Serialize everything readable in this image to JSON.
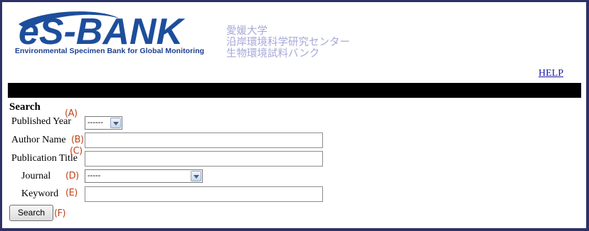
{
  "header": {
    "logo_text": "eS-BANK",
    "tagline": "Environmental Specimen Bank for Global Monitoring",
    "jp_lines": [
      "愛媛大学",
      "沿岸環境科学研究センター",
      "生物環境試料バンク"
    ],
    "help_link": "HELP"
  },
  "form": {
    "title": "Search",
    "published_year": {
      "label": "Published Year",
      "marker": "(A)",
      "selected": "------"
    },
    "author_name": {
      "label": "Author Name",
      "marker": "(B)",
      "value": ""
    },
    "publication_title": {
      "label": "Publication Title",
      "marker": "(C)",
      "value": ""
    },
    "journal": {
      "label": "Journal",
      "marker": "(D)",
      "selected": "-----"
    },
    "keyword": {
      "label": "Keyword",
      "marker": "(E)",
      "value": ""
    },
    "search_button": {
      "label": "Search",
      "marker": "(F)"
    }
  },
  "colors": {
    "logo_blue": "#1d4e9c",
    "jp_text": "#a6a8d8",
    "marker": "#c0461a",
    "bar": "#000000",
    "frame": "#2c3266"
  }
}
